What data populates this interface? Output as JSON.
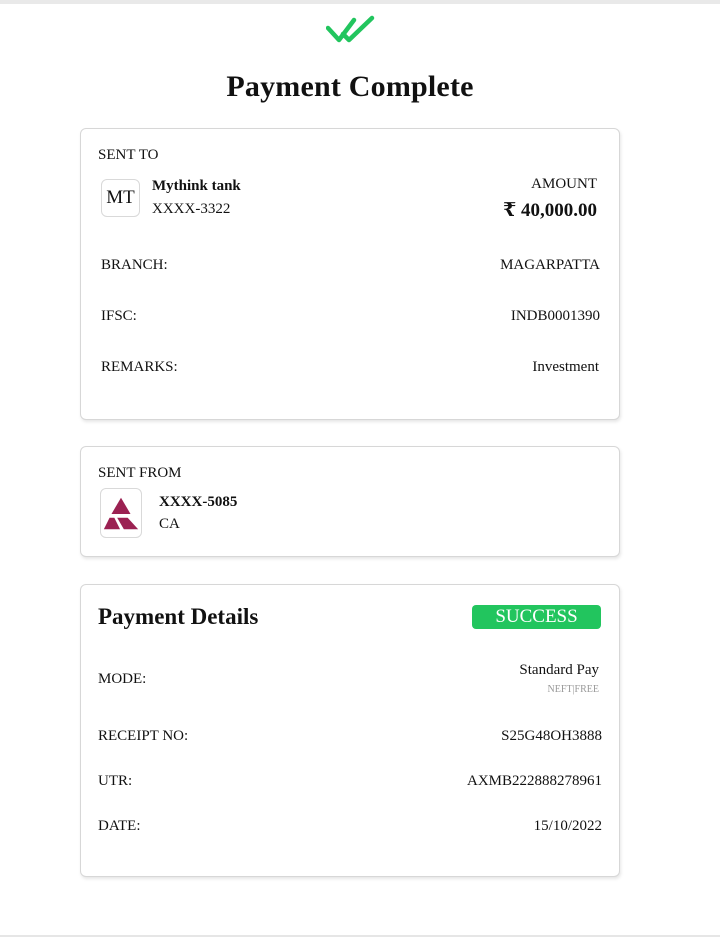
{
  "header": {
    "title": "Payment Complete"
  },
  "sent_to": {
    "section_label": "SENT TO",
    "avatar_initials": "MT",
    "name": "Mythink tank",
    "account": "XXXX-3322",
    "amount_label": "AMOUNT",
    "amount": "₹ 40,000.00",
    "branch_label": "BRANCH:",
    "branch_value": "MAGARPATTA",
    "ifsc_label": "IFSC:",
    "ifsc_value": "INDB0001390",
    "remarks_label": "REMARKS:",
    "remarks_value": "Investment"
  },
  "sent_from": {
    "section_label": "SENT FROM",
    "account": "XXXX-5085",
    "account_type": "CA",
    "bank_logo_icon": "axis-bank-logo"
  },
  "payment_details": {
    "title": "Payment Details",
    "status": "SUCCESS",
    "mode_label": "MODE:",
    "mode_value": "Standard Pay",
    "mode_sub": "NEFT|FREE",
    "receipt_label": "RECEIPT NO:",
    "receipt_value": "S25G48OH3888",
    "utr_label": "UTR:",
    "utr_value": "AXMB222888278961",
    "date_label": "DATE:",
    "date_value": "15/10/2022"
  },
  "colors": {
    "accent_green": "#22c55e",
    "brand_maroon": "#9b2152"
  }
}
